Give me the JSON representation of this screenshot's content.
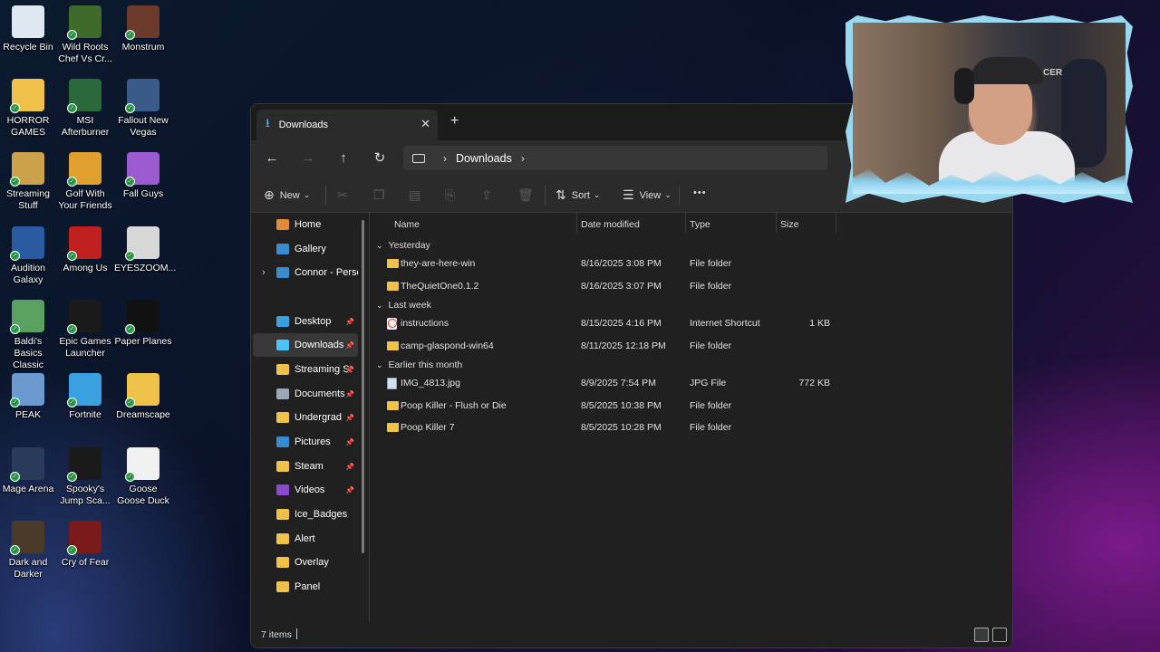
{
  "desktop": {
    "icons": [
      {
        "label": "Recycle Bin",
        "bg": "#dfe8f0"
      },
      {
        "label": "Wild Roots Chef Vs Cr...",
        "bg": "#3f6b2a"
      },
      {
        "label": "Monstrum",
        "bg": "#6b3a2a"
      },
      {
        "label": "HORROR GAMES",
        "bg": "#f0c24a"
      },
      {
        "label": "MSI Afterburner",
        "bg": "#2a6a3a"
      },
      {
        "label": "Fallout New Vegas",
        "bg": "#3a5a8a"
      },
      {
        "label": "Streaming Stuff",
        "bg": "#c9a24a"
      },
      {
        "label": "Golf With Your Friends",
        "bg": "#e0a030"
      },
      {
        "label": "Fall Guys",
        "bg": "#9a5ad0"
      },
      {
        "label": "Audition Galaxy",
        "bg": "#2a5aa0"
      },
      {
        "label": "Among Us",
        "bg": "#c02020"
      },
      {
        "label": "EYESZOOM...",
        "bg": "#d8d8d8"
      },
      {
        "label": "Baldi's Basics Classic Rem...",
        "bg": "#5aa060"
      },
      {
        "label": "Epic Games Launcher",
        "bg": "#1a1a1a"
      },
      {
        "label": "Paper Planes",
        "bg": "#111111"
      },
      {
        "label": "PEAK",
        "bg": "#6a9ad0"
      },
      {
        "label": "Fortnite",
        "bg": "#3aa0e0"
      },
      {
        "label": "Dreamscape",
        "bg": "#f0c24a"
      },
      {
        "label": "Mage Arena",
        "bg": "#2a3a5a"
      },
      {
        "label": "Spooky's Jump Sca...",
        "bg": "#1a1a1a"
      },
      {
        "label": "Goose Goose Duck",
        "bg": "#f0f0f0"
      },
      {
        "label": "Dark and Darker",
        "bg": "#4a3a2a"
      },
      {
        "label": "Cry of Fear",
        "bg": "#7a1a1a"
      }
    ],
    "icon_glyphs": {
      "recycle": "♻",
      "epic": "EPIC",
      "fortnite": "F",
      "plane": "✈"
    }
  },
  "explorer": {
    "tab_title": "Downloads",
    "close_glyph": "✕",
    "newtab_glyph": "+",
    "nav": {
      "back": "←",
      "forward": "→",
      "up": "↑",
      "refresh": "↻",
      "crumb": "Downloads",
      "chevron": "›"
    },
    "toolbar": {
      "new_label": "New",
      "sort_label": "Sort",
      "view_label": "View",
      "more": "•••",
      "dd": "⌄"
    },
    "sidebar": [
      {
        "label": "Home",
        "color": "#e08a3a",
        "pinned": false
      },
      {
        "label": "Gallery",
        "color": "#3a8ad0",
        "pinned": false
      },
      {
        "label": "Connor - Person",
        "color": "#3a8ad0",
        "pinned": false,
        "expand": "›"
      },
      {
        "label": "Desktop",
        "color": "#3aa0e0",
        "pinned": true
      },
      {
        "label": "Downloads",
        "color": "#4cc2ff",
        "pinned": true,
        "active": true
      },
      {
        "label": "Streaming St",
        "color": "#f0c24a",
        "pinned": true
      },
      {
        "label": "Documents",
        "color": "#9aa8b8",
        "pinned": true
      },
      {
        "label": "Undergrad",
        "color": "#f0c24a",
        "pinned": true
      },
      {
        "label": "Pictures",
        "color": "#3a8ad0",
        "pinned": true
      },
      {
        "label": "Steam",
        "color": "#f0c24a",
        "pinned": true
      },
      {
        "label": "Videos",
        "color": "#8a4ad0",
        "pinned": true
      },
      {
        "label": "Ice_Badges",
        "color": "#f0c24a",
        "pinned": false
      },
      {
        "label": "Alert",
        "color": "#f0c24a",
        "pinned": false
      },
      {
        "label": "Overlay",
        "color": "#f0c24a",
        "pinned": false
      },
      {
        "label": "Panel",
        "color": "#f0c24a",
        "pinned": false
      }
    ],
    "pin_glyph": "📌",
    "columns": {
      "name": "Name",
      "date": "Date modified",
      "type": "Type",
      "size": "Size"
    },
    "groups": [
      {
        "label": "Yesterday",
        "toggle": "⌄",
        "rows": [
          {
            "name": "they-are-here-win",
            "date": "8/16/2025 3:08 PM",
            "type": "File folder",
            "size": "",
            "kind": "folder"
          },
          {
            "name": "TheQuietOne0.1.2",
            "date": "8/16/2025 3:07 PM",
            "type": "File folder",
            "size": "",
            "kind": "folder"
          }
        ]
      },
      {
        "label": "Last week",
        "toggle": "⌄",
        "rows": [
          {
            "name": "instructions",
            "date": "8/15/2025 4:16 PM",
            "type": "Internet Shortcut",
            "size": "1 KB",
            "kind": "url"
          },
          {
            "name": "camp-glaspond-win64",
            "date": "8/11/2025 12:18 PM",
            "type": "File folder",
            "size": "",
            "kind": "folder"
          }
        ]
      },
      {
        "label": "Earlier this month",
        "toggle": "⌄",
        "rows": [
          {
            "name": "IMG_4813.jpg",
            "date": "8/9/2025 7:54 PM",
            "type": "JPG File",
            "size": "772 KB",
            "kind": "jpg"
          },
          {
            "name": "Poop Killer - Flush or Die",
            "date": "8/5/2025 10:38 PM",
            "type": "File folder",
            "size": "",
            "kind": "folder"
          },
          {
            "name": "Poop Killer 7",
            "date": "8/5/2025 10:28 PM",
            "type": "File folder",
            "size": "",
            "kind": "folder"
          }
        ]
      }
    ],
    "status": {
      "count": "7 items"
    }
  },
  "webcam": {
    "brand": "CER"
  },
  "colors": {
    "accent": "#4cc2ff",
    "folder": "#f0c24a",
    "window_bg": "#202020"
  }
}
